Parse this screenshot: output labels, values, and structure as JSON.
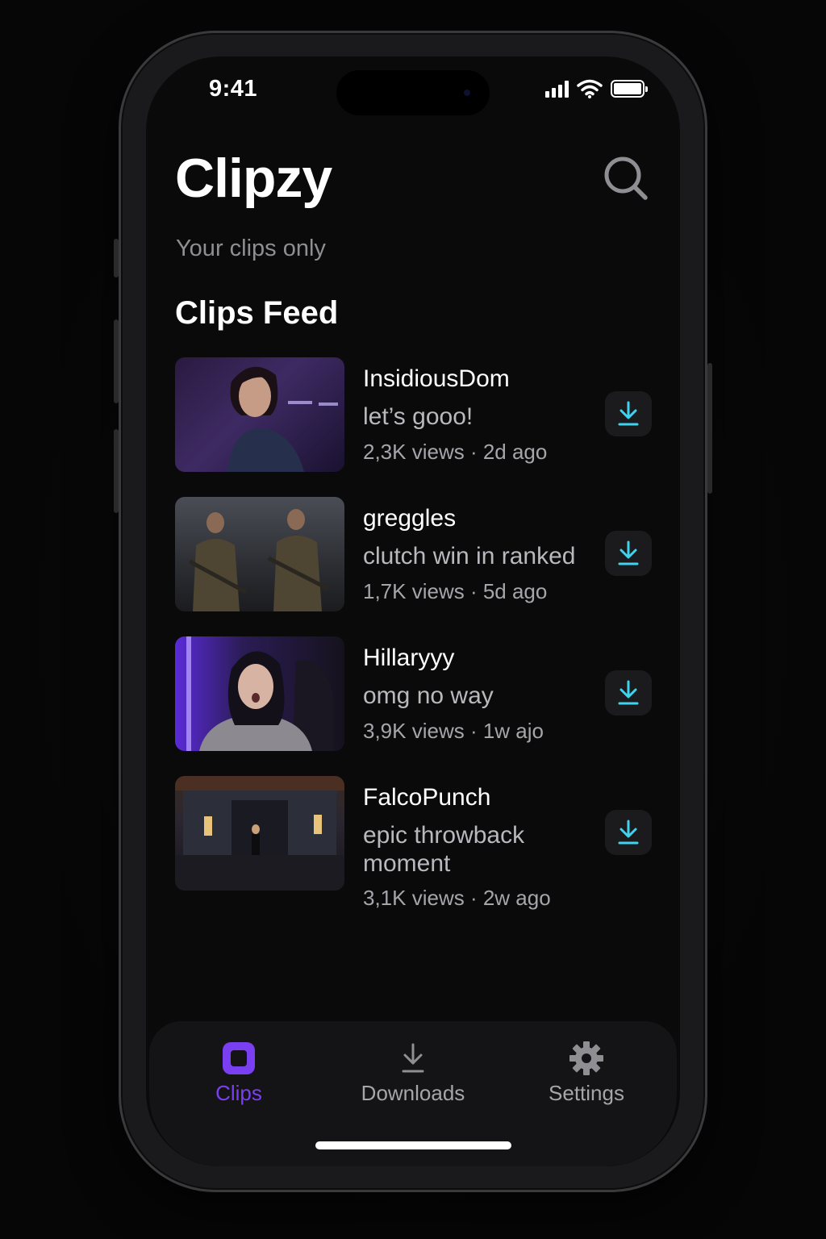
{
  "status_bar": {
    "time": "9:41"
  },
  "header": {
    "title": "Clipzy",
    "subtitle": "Your clips only",
    "search_icon": "search-icon"
  },
  "feed": {
    "title": "Clips Feed",
    "clips": [
      {
        "user": "InsidiousDom",
        "caption": "let’s gooo!",
        "meta": "2,3K views · 2d ago"
      },
      {
        "user": "greggles",
        "caption": "clutch win in ranked",
        "meta": "1,7K views · 5d ago"
      },
      {
        "user": "Hillaryyy",
        "caption": "omg no way",
        "meta": "3,9K views · 1w ajo"
      },
      {
        "user": "FalcoPunch",
        "caption": "epic throwback moment",
        "meta": "3,1K views · 2w ago"
      }
    ]
  },
  "tabbar": {
    "tabs": [
      {
        "label": "Clips",
        "icon": "clips-icon",
        "active": true
      },
      {
        "label": "Downloads",
        "icon": "download-icon",
        "active": false
      },
      {
        "label": "Settings",
        "icon": "gear-icon",
        "active": false
      }
    ]
  },
  "colors": {
    "accent": "#7b3ff2",
    "download": "#3fd3f0",
    "background": "#0a0a0b",
    "muted": "#8e8e93"
  }
}
